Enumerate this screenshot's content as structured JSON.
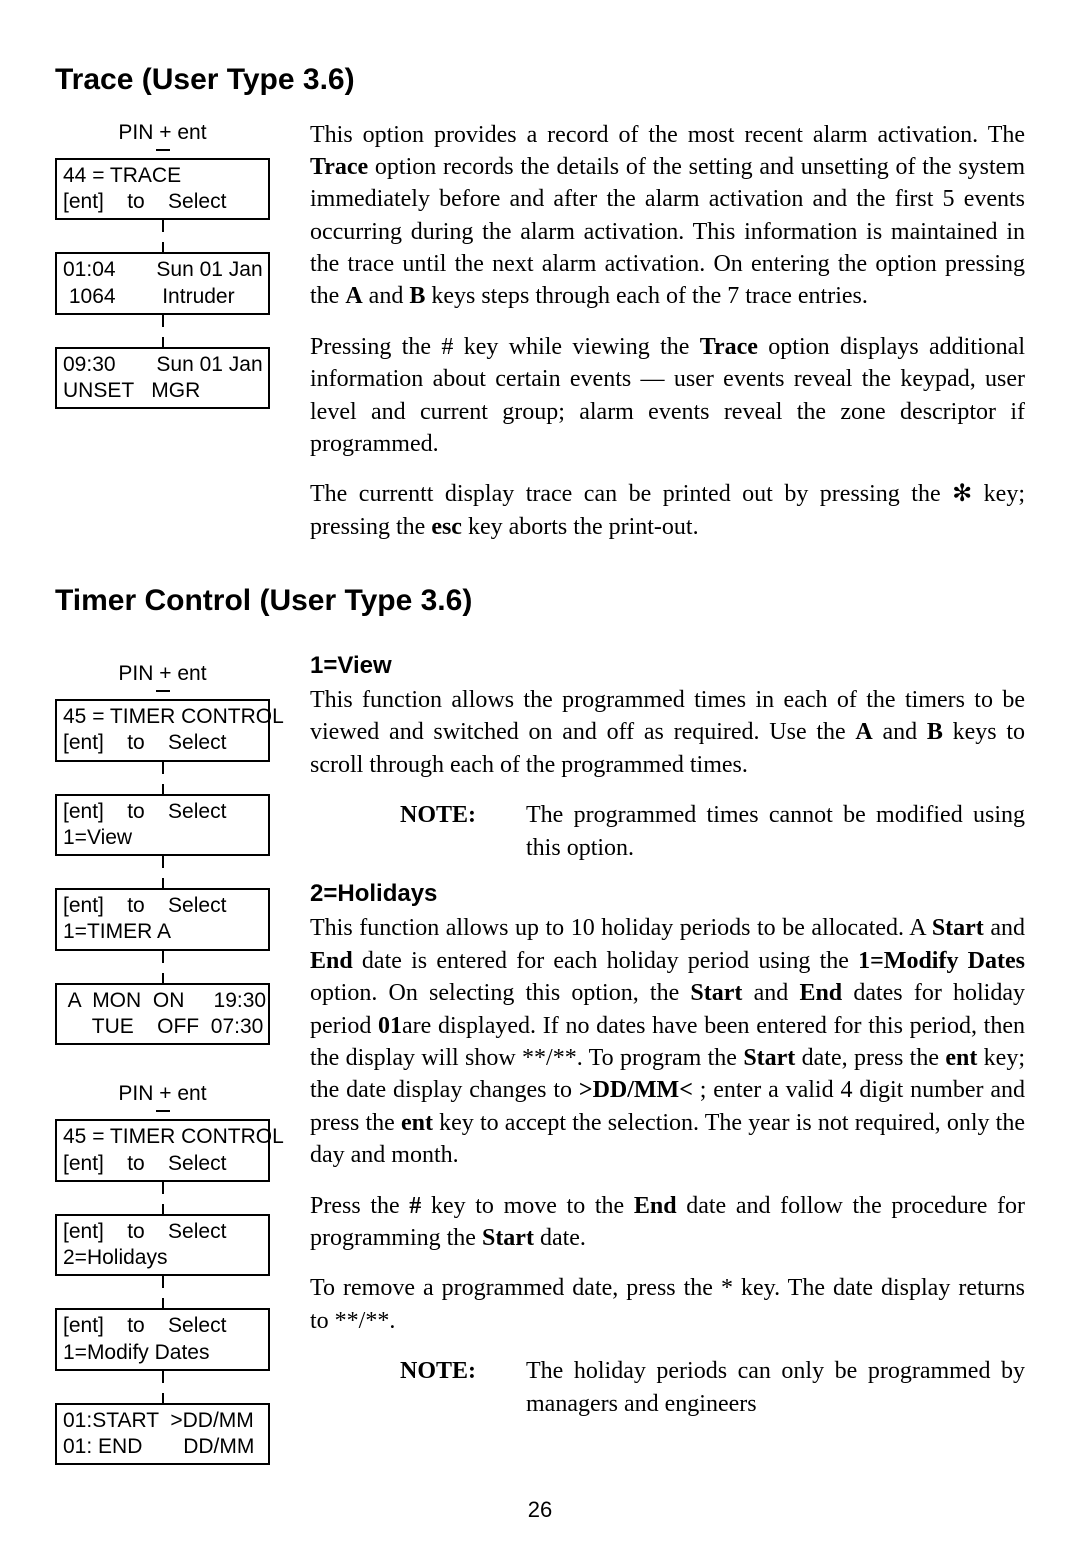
{
  "page_number": "26",
  "section_trace": {
    "heading": "Trace (User Type 3.6)",
    "diagram": {
      "pin": "PIN + ent",
      "box1_l1": "44 = TRACE",
      "box1_l2": "[ent]    to    Select",
      "box2_l1": "01:04       Sun 01 Jan",
      "box2_l2": " 1064        Intruder",
      "box3_l1": "09:30       Sun 01 Jan",
      "box3_l2": "UNSET   MGR"
    },
    "para1_a": "This option provides a record of the most recent alarm activation. The ",
    "para1_b": "Trace",
    "para1_c": " option records the details of the setting and unsetting of the system immediately before and after the alarm activation and the first 5 events occurring during the alarm activation. This information is maintained in the trace until the next alarm activation.  On entering the option pressing the ",
    "para1_d": "A",
    "para1_e": " and ",
    "para1_f": "B",
    "para1_g": " keys steps through each of the 7 trace entries.",
    "para2_a": "Pressing the # key while viewing the ",
    "para2_b": "Trace",
    "para2_c": " option displays additional information about certain events — user events reveal the keypad, user level and current group; alarm events reveal the zone descriptor if programmed.",
    "para3_a": "The currentt display trace can be printed out by pressing the ",
    "para3_b": "✻",
    "para3_c": " key; pressing the ",
    "para3_d": "esc",
    "para3_e": " key aborts the print-out."
  },
  "section_timer": {
    "heading": "Timer Control (User Type 3.6)",
    "sub1": "1=View",
    "sub2": "2=Holidays",
    "diagram1": {
      "pin": "PIN + ent",
      "box1_l1": "45 = TIMER CONTROL",
      "box1_l2": "[ent]    to    Select",
      "box2_l1": "[ent]    to    Select",
      "box2_l2": "1=View",
      "box3_l1": "[ent]    to    Select",
      "box3_l2": "1=TIMER A",
      "box4_l1": " A  MON  ON     19:30",
      "box4_l2": "     TUE    OFF  07:30"
    },
    "diagram2": {
      "pin": "PIN + ent",
      "box1_l1": "45 = TIMER CONTROL",
      "box1_l2": "[ent]    to    Select",
      "box2_l1": "[ent]    to    Select",
      "box2_l2": "2=Holidays",
      "box3_l1": "[ent]    to    Select",
      "box3_l2": "1=Modify Dates",
      "box4_l1": "01:START  >DD/MM",
      "box4_l2": "01: END       DD/MM"
    },
    "view_para_a": "This function allows the programmed times in each of the timers to be viewed and switched on and off as required. Use the ",
    "view_para_b": "A",
    "view_para_c": " and ",
    "view_para_d": "B",
    "view_para_e": " keys to scroll through each of the programmed times.",
    "note1_label": "NOTE:",
    "note1_text": "The programmed times cannot be modified using this option.",
    "hol_para1_a": "This function allows up to 10 holiday periods to be allocated. A ",
    "hol_para1_b": "Start",
    "hol_para1_c": " and ",
    "hol_para1_d": "End",
    "hol_para1_e": " date is entered for each holiday period using the ",
    "hol_para1_f": "1=Modify Dates",
    "hol_para1_g": " option. On selecting this option, the ",
    "hol_para1_h": "Start",
    "hol_para1_i": " and ",
    "hol_para1_j": "End",
    "hol_para1_k": " dates for holiday period ",
    "hol_para1_l": "01",
    "hol_para1_m": "are displayed. If no dates have been entered for this period, then the display will show **/**. To program the ",
    "hol_para1_n": "Start",
    "hol_para1_o": " date, press the ",
    "hol_para1_p": "ent",
    "hol_para1_q": " key; the date display changes to ",
    "hol_para1_r": ">DD/MM<",
    "hol_para1_s": " ; enter a valid 4 digit number and press the ",
    "hol_para1_t": "ent",
    "hol_para1_u": " key to accept the selection. The year is not required, only the day and month.",
    "hol_para2_a": "Press the ",
    "hol_para2_b": "#",
    "hol_para2_c": " key to move to the ",
    "hol_para2_d": "End",
    "hol_para2_e": " date and follow the procedure for programming the ",
    "hol_para2_f": "Start",
    "hol_para2_g": " date.",
    "hol_para3_a": "To remove a programmed date, press the * key. The date display returns to **/**.",
    "note2_label": "NOTE:",
    "note2_text": "The holiday periods can only be programmed by managers and engineers"
  }
}
